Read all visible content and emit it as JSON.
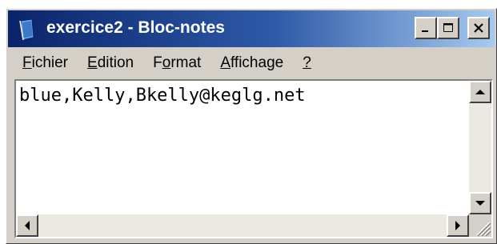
{
  "window": {
    "title": "exercice2 - Bloc-notes",
    "icon": "notepad-icon"
  },
  "menu": {
    "items": [
      {
        "accel": "F",
        "rest": "ichier"
      },
      {
        "accel": "E",
        "rest": "dition"
      },
      {
        "pre": "F",
        "accel": "o",
        "rest": "rmat"
      },
      {
        "accel": "A",
        "rest": "ffichage"
      },
      {
        "accel": "?",
        "rest": ""
      }
    ]
  },
  "editor": {
    "content": "blue,Kelly,Bkelly@keglg.net"
  },
  "colors": {
    "titlebar_start": "#0a246a",
    "titlebar_end": "#a6caf0",
    "chrome": "#d4d0c8"
  }
}
